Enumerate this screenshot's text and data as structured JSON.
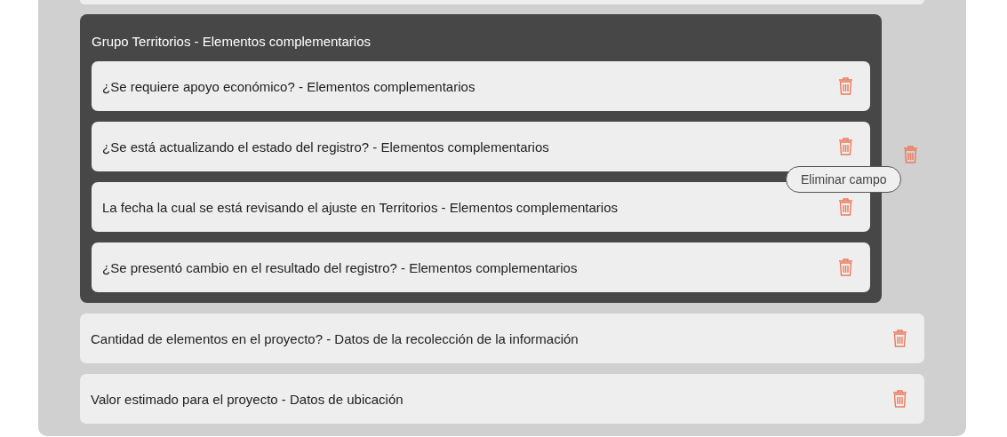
{
  "group": {
    "title": "Grupo Territorios - Elementos complementarios",
    "fields": [
      {
        "label": "¿Se requiere apoyo económico? - Elementos complementarios"
      },
      {
        "label": "¿Se está actualizando el estado del registro? - Elementos complementarios"
      },
      {
        "label": "La fecha la cual se está revisando el ajuste en Territorios - Elementos complementarios"
      },
      {
        "label": "¿Se presentó cambio en el resultado del registro? - Elementos complementarios"
      }
    ]
  },
  "tooltip": "Eliminar campo",
  "fields": [
    {
      "label": "Cantidad de elementos en el proyecto? - Datos de la recolección de la información"
    },
    {
      "label": "Valor estimado para el proyecto - Datos de ubicación"
    }
  ]
}
